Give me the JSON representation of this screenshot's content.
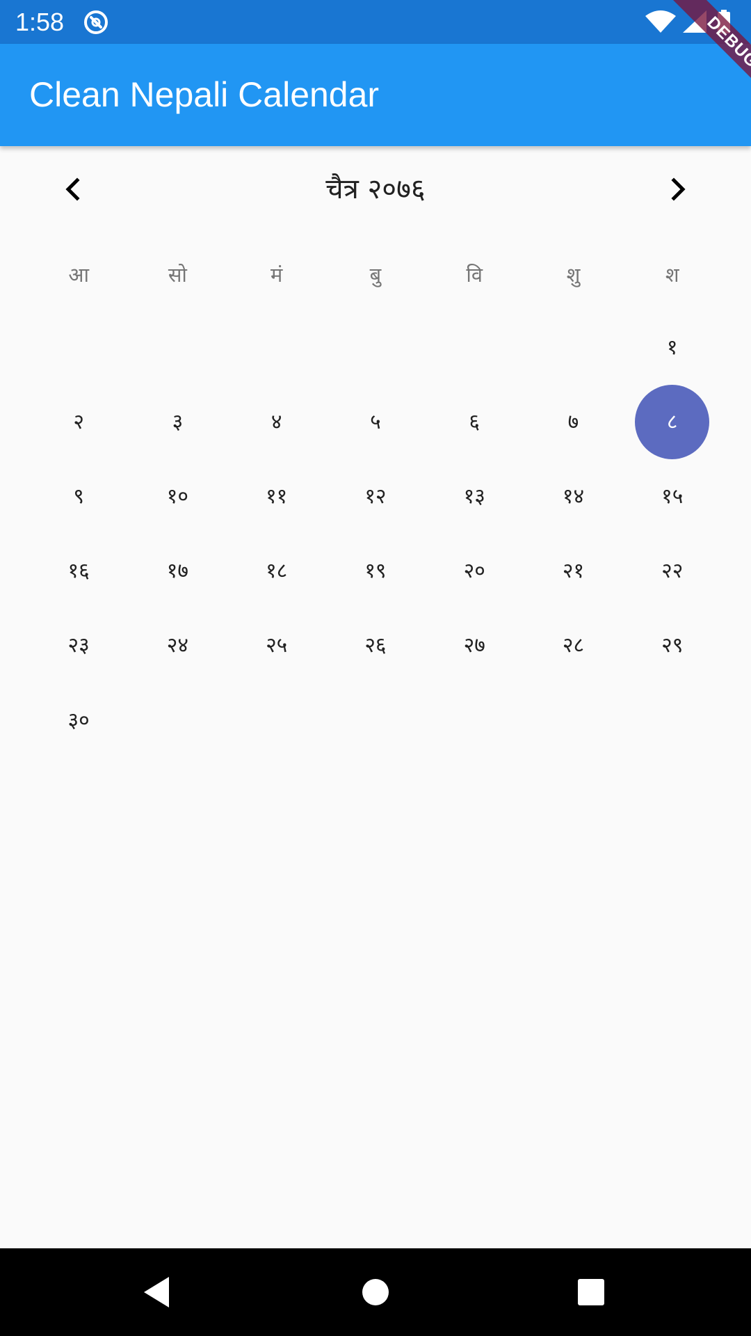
{
  "status_bar": {
    "time": "1:58",
    "background_color": "#1976d2",
    "icons": [
      "notification-icon",
      "wifi-icon",
      "cell-signal-icon",
      "battery-icon"
    ]
  },
  "app_bar": {
    "title": "Clean Nepali Calendar",
    "background_color": "#2196f3"
  },
  "debug_banner": {
    "label": "DEBUG"
  },
  "calendar": {
    "month_title": "चैत्र २०७६",
    "prev_icon": "chevron-left-icon",
    "next_icon": "chevron-right-icon",
    "weekdays": [
      "आ",
      "सो",
      "मं",
      "बु",
      "वि",
      "शु",
      "श"
    ],
    "leading_blank_days": 6,
    "days": [
      "१",
      "२",
      "३",
      "४",
      "५",
      "६",
      "७",
      "८",
      "९",
      "१०",
      "११",
      "१२",
      "१३",
      "१४",
      "१५",
      "१६",
      "१७",
      "१८",
      "१९",
      "२०",
      "२१",
      "२२",
      "२३",
      "२४",
      "२५",
      "२६",
      "२७",
      "२८",
      "२९",
      "३०"
    ],
    "selected_day": "८",
    "selected_color": "#5c6bc0"
  },
  "system_nav": {
    "buttons": [
      "back-icon",
      "home-icon",
      "recents-icon"
    ]
  }
}
